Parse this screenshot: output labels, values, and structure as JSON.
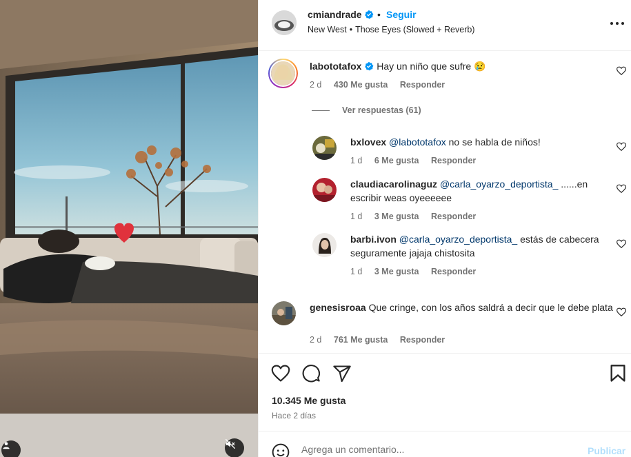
{
  "post": {
    "author": "cmiandrade",
    "follow_label": "Seguir",
    "dot": "•",
    "location": "New West",
    "audio": "Those Eyes (Slowed + Reverb)",
    "media_heart": "❤️"
  },
  "comments": [
    {
      "user": "labototafox",
      "text": "Hay un niño que sufre 😢",
      "age": "2 d",
      "likes": "430 Me gusta",
      "reply": "Responder",
      "view_replies": "Ver respuestas (61)"
    },
    {
      "user": "bxlovex",
      "mention": "@labototafox",
      "text": "no se habla de niños!",
      "age": "1 d",
      "likes": "6 Me gusta",
      "reply": "Responder"
    },
    {
      "user": "claudiacarolinaguz",
      "mention": "@carla_oyarzo_deportista_",
      "text": "......en escribir weas oyeeeeee",
      "age": "1 d",
      "likes": "3 Me gusta",
      "reply": "Responder"
    },
    {
      "user": "barbi.ivon",
      "mention": "@carla_oyarzo_deportista_",
      "text": "estás de cabecera seguramente jajaja chistosita",
      "age": "1 d",
      "likes": "3 Me gusta",
      "reply": "Responder"
    },
    {
      "user": "genesisroaa",
      "text": "Que cringe, con los años saldrá a decir que le debe plata",
      "age": "2 d",
      "likes": "761 Me gusta",
      "reply": "Responder"
    }
  ],
  "footer": {
    "likes_count": "10.345 Me gusta",
    "time_ago": "Hace 2 días",
    "comment_placeholder": "Agrega un comentario...",
    "publish_label": "Publicar"
  },
  "colors": {
    "link_blue": "#0095f6",
    "mention_blue": "#00376b",
    "verified_blue": "#0095f6",
    "muted_text": "#737373"
  },
  "icons": [
    "verified-icon",
    "more-icon",
    "heart-icon",
    "comment-icon",
    "share-icon",
    "bookmark-icon",
    "emoji-icon",
    "mute-icon",
    "user-tag-icon"
  ]
}
